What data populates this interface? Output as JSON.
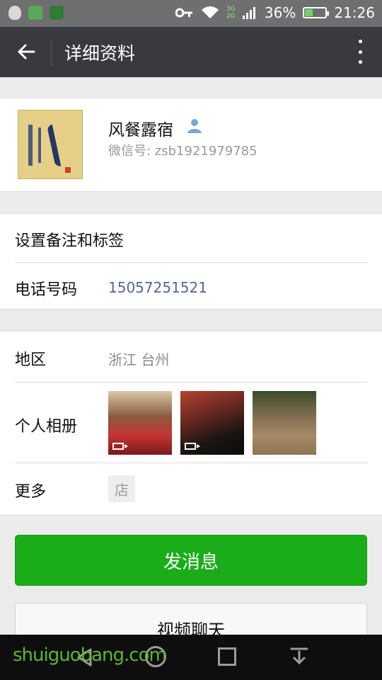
{
  "status_bar": {
    "battery": "36%",
    "time": "21:26",
    "network": "3G 2G",
    "battery_level": 0.36
  },
  "app_bar": {
    "title": "详细资料"
  },
  "profile": {
    "name": "风餐露宿",
    "wechat_id": "微信号: zsb1921979785"
  },
  "rows": {
    "remark_label": "设置备注和标签",
    "phone_label": "电话号码",
    "phone_value": "15057251521",
    "region_label": "地区",
    "region_value": "浙江  台州",
    "album_label": "个人相册",
    "more_label": "更多",
    "more_icon_text": "店"
  },
  "buttons": {
    "send_message": "发消息",
    "video_chat": "视频聊天"
  },
  "watermark": "shuiguobang.com",
  "colors": {
    "status_bar": "#6f6f6f",
    "app_bar": "#393a3f",
    "primary_green": "#1aad19",
    "link_blue": "#546791"
  }
}
